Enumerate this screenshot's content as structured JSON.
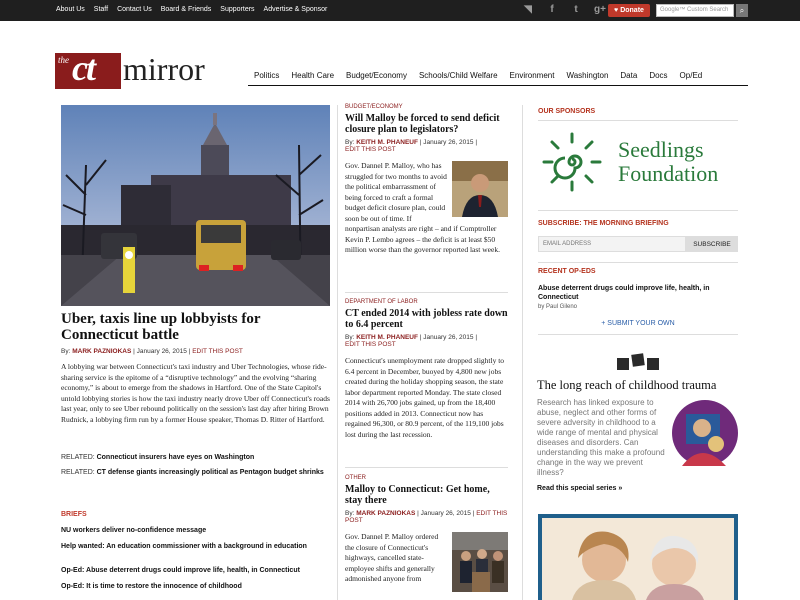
{
  "topbar": {
    "links": [
      "About Us",
      "Staff",
      "Contact Us",
      "Board & Friends",
      "Supporters",
      "Advertise & Sponsor"
    ],
    "social_icons": [
      "rss-icon",
      "facebook-icon",
      "twitter-icon",
      "google-plus-icon"
    ],
    "social_glyphs": [
      "◥",
      "f",
      "t",
      "g+"
    ],
    "donate_label": "Donate",
    "search_placeholder": "Google™ Custom Search"
  },
  "logo": {
    "the": "the",
    "ct": "ct",
    "mirror": "mirror"
  },
  "nav": [
    "Politics",
    "Health Care",
    "Budget/Economy",
    "Schools/Child Welfare",
    "Environment",
    "Washington",
    "Data",
    "Docs",
    "Op/Ed"
  ],
  "lead": {
    "title": "Uber, taxis line up lobbyists for Connecticut battle",
    "by_label": "By:",
    "author": "MARK PAZNIOKAS",
    "date": "January 26, 2015",
    "edit": "EDIT THIS POST",
    "body": "A lobbying war between Connecticut's taxi industry and Uber Technologies, whose ride-sharing service is the epitome of a “disruptive technology” and the evolving “sharing economy,” is about to emerge from the shadows in Hartford. One of the State Capitol's untold lobbying stories is how the taxi industry nearly drove Uber off Connecticut's roads last year, only to see Uber rebound politically on the session's last day after hiring Brown Rudnick, a lobbying firm run by a former House speaker, Thomas D. Ritter of Hartford.",
    "related": [
      {
        "label": "RELATED:",
        "text": "Connecticut insurers have eyes on Washington"
      },
      {
        "label": "RELATED:",
        "text": "CT defense giants increasingly political as Pentagon budget shrinks"
      }
    ]
  },
  "briefs": {
    "heading": "BRIEFS",
    "items": [
      "NU workers deliver no-confidence message",
      "Help wanted: An education commissioner with a background in education",
      "Op-Ed: Abuse deterrent drugs could improve life, health, in Connecticut",
      "Op-Ed: It is time to restore the innocence of childhood"
    ]
  },
  "middle": [
    {
      "category": "BUDGET/ECONOMY",
      "title": "Will Malloy be forced to send deficit closure plan to legislators?",
      "by_label": "By:",
      "author": "KEITH M. PHANEUF",
      "date": "January 26, 2015",
      "edit": "EDIT THIS POST",
      "body": "Gov. Dannel P. Malloy, who has struggled for two months to avoid the political embarrassment of being forced to craft a formal budget deficit closure plan, could soon be out of time. If nonpartisan analysts are right – and if Comptroller Kevin P. Lembo agrees – the deficit is at least $50 million worse than the governor reported last week."
    },
    {
      "category": "DEPARTMENT OF LABOR",
      "title": "CT ended 2014 with jobless rate down to 6.4 percent",
      "by_label": "By:",
      "author": "KEITH M. PHANEUF",
      "date": "January 26, 2015",
      "edit": "EDIT THIS POST",
      "body": "Connecticut's unemployment rate dropped slightly to 6.4 percent in December, buoyed by 4,800 new jobs created during the holiday shopping season, the state labor department reported Monday. The state closed 2014 with 26,700 jobs gained, up from the 18,400 positions added in 2013. Connecticut now has regained 96,300, or 80.9 percent, of the 119,100 jobs lost during the last recession."
    },
    {
      "category": "OTHER",
      "title": "Malloy to Connecticut: Get home, stay there",
      "by_label": "By:",
      "author": "MARK PAZNIOKAS",
      "date": "January 26, 2015",
      "edit": "EDIT THIS POST",
      "body": "Gov. Dannel P. Malloy ordered the closure of Connecticut's highways, cancelled state-employee shifts and generally admonished anyone from"
    }
  ],
  "sidebar": {
    "sponsors_heading": "OUR SPONSORS",
    "sponsor_name_1": "Seedlings",
    "sponsor_name_2": "Foundation",
    "subscribe_heading": "SUBSCRIBE: THE MORNING BRIEFING",
    "email_placeholder": "EMAIL ADDRESS",
    "subscribe_button": "SUBSCRIBE",
    "recent_heading": "RECENT OP-EDS",
    "oped_title": "Abuse deterrent drugs could improve life, health, in Connecticut",
    "oped_by": "by Paul Gileno",
    "submit_label": "+ SUBMIT YOUR OWN",
    "special_title": "The long reach of childhood trauma",
    "special_body": "Research has linked exposure to abuse, neglect and other forms of severe adversity in childhood to a wide range of mental and physical diseases and disorders. Can understanding this make a profound change in the way we prevent illness?",
    "special_link": "Read this special series »"
  },
  "colors": {
    "accent": "#8a1c1c",
    "briefs_red": "#c0392b",
    "sponsor_green": "#2a7a3b",
    "link_blue": "#2a5ea8"
  }
}
